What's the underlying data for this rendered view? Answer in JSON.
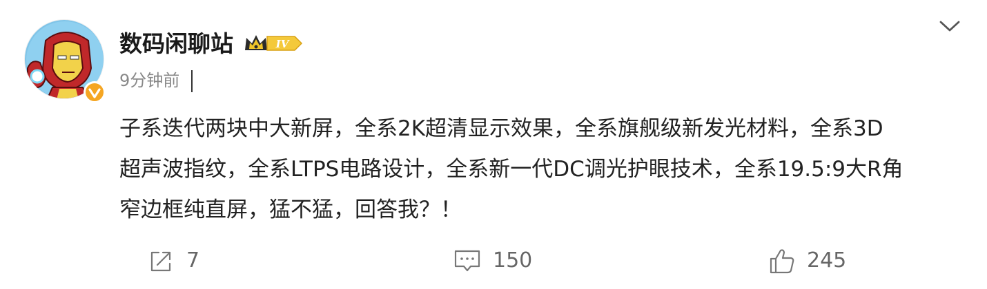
{
  "post": {
    "author": "数码闲聊站",
    "vip_level": "IV",
    "time": "9分钟前",
    "body_lines": [
      "子系迭代两块中大新屏，全系2K超清显示效果，全系旗舰级新发光材料，全系3D",
      "超声波指纹，全系LTPS电路设计，全系新一代DC调光护眼技术，全系19.5:9大R角",
      "窄边框纯直屏，猛不猛，回答我？！"
    ]
  },
  "actions": {
    "share_count": "7",
    "comment_count": "150",
    "like_count": "245"
  },
  "icons": {
    "avatar": "iron-man-avatar",
    "verified": "verified-badge-icon",
    "vip": "crown-vip-icon",
    "more": "chevron-down-icon",
    "share": "share-icon",
    "comment": "comment-icon",
    "like": "thumbs-up-icon"
  },
  "colors": {
    "verified_orange": "#f5a623",
    "vip_gold": "#e6b325",
    "text_muted": "#888888"
  }
}
